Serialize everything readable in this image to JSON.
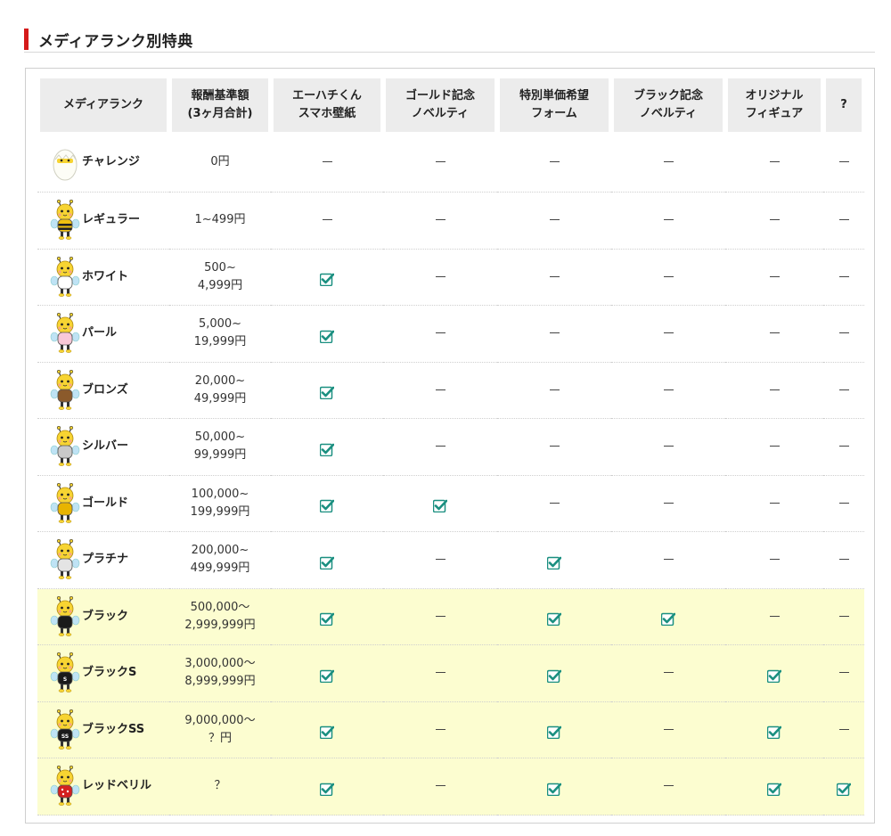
{
  "heading": {
    "title": "メディアランク別特典",
    "accent_color": "#d51a1a"
  },
  "table": {
    "headers": [
      "メディアランク",
      "報酬基準額\n(3ヶ月合計)",
      "エーハチくん\nスマホ壁紙",
      "ゴールド記念\nノベルティ",
      "特別単価希望\nフォーム",
      "ブラック記念\nノベルティ",
      "オリジナル\nフィギュア",
      "?"
    ],
    "rows": [
      {
        "name": "チャレンジ",
        "amount": "0円",
        "avatar": "egg-icon",
        "perks": [
          false,
          false,
          false,
          false,
          false,
          false
        ]
      },
      {
        "name": "レギュラー",
        "amount": "1~499円",
        "avatar": "bee-regular-icon",
        "perks": [
          false,
          false,
          false,
          false,
          false,
          false
        ]
      },
      {
        "name": "ホワイト",
        "amount": "500~\n4,999円",
        "avatar": "bee-white-icon",
        "perks": [
          true,
          false,
          false,
          false,
          false,
          false
        ]
      },
      {
        "name": "パール",
        "amount": "5,000~\n19,999円",
        "avatar": "bee-pearl-icon",
        "perks": [
          true,
          false,
          false,
          false,
          false,
          false
        ]
      },
      {
        "name": "ブロンズ",
        "amount": "20,000~\n49,999円",
        "avatar": "bee-bronze-icon",
        "perks": [
          true,
          false,
          false,
          false,
          false,
          false
        ]
      },
      {
        "name": "シルバー",
        "amount": "50,000~\n99,999円",
        "avatar": "bee-silver-icon",
        "perks": [
          true,
          false,
          false,
          false,
          false,
          false
        ]
      },
      {
        "name": "ゴールド",
        "amount": "100,000~\n199,999円",
        "avatar": "bee-gold-icon",
        "perks": [
          true,
          true,
          false,
          false,
          false,
          false
        ]
      },
      {
        "name": "プラチナ",
        "amount": "200,000~\n499,999円",
        "avatar": "bee-platinum-icon",
        "perks": [
          true,
          false,
          true,
          false,
          false,
          false
        ]
      },
      {
        "name": "ブラック",
        "amount": "500,000～\n2,999,999円",
        "avatar": "bee-black-icon",
        "highlight": true,
        "perks": [
          true,
          false,
          true,
          true,
          false,
          false
        ]
      },
      {
        "name": "ブラックS",
        "amount": "3,000,000～\n8,999,999円",
        "avatar": "bee-black-s-icon",
        "highlight": true,
        "shirt_text": "S",
        "perks": [
          true,
          false,
          true,
          false,
          true,
          false
        ]
      },
      {
        "name": "ブラックSS",
        "amount": "9,000,000～\n？円",
        "avatar": "bee-black-ss-icon",
        "highlight": true,
        "shirt_text": "SS",
        "perks": [
          true,
          false,
          true,
          false,
          true,
          false
        ]
      },
      {
        "name": "レッドベリル",
        "amount": "？",
        "avatar": "bee-red-beryl-icon",
        "highlight": true,
        "perks": [
          true,
          false,
          true,
          false,
          true,
          true
        ]
      }
    ]
  },
  "colors": {
    "check": "#1a8f80",
    "highlight_row": "#fcfdd0",
    "header_bg": "#ececec",
    "bee_yellow": "#f7d432",
    "shirt": {
      "bee-regular-icon": "#f0c010",
      "bee-white-icon": "#ffffff",
      "bee-pearl-icon": "#f8c8d8",
      "bee-bronze-icon": "#8b5a2b",
      "bee-silver-icon": "#c9c9c9",
      "bee-gold-icon": "#e8b400",
      "bee-platinum-icon": "#e4e4e4",
      "bee-black-icon": "#1a1a1a",
      "bee-black-s-icon": "#1a1a1a",
      "bee-black-ss-icon": "#1a1a1a",
      "bee-red-beryl-icon": "#d42020"
    }
  }
}
